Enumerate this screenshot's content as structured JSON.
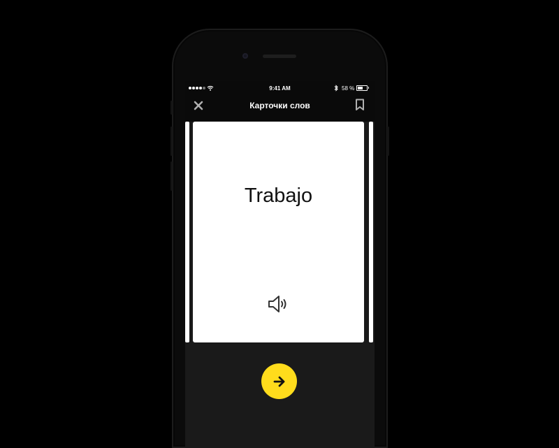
{
  "status_bar": {
    "time": "9:41 AM",
    "battery_percent": "58 %",
    "signal_bars": 4,
    "icons": [
      "signal-icon",
      "wifi-icon",
      "bluetooth-icon",
      "battery-icon"
    ]
  },
  "navbar": {
    "title": "Карточки слов",
    "close_icon": "close-icon",
    "bookmark_icon": "bookmark-icon"
  },
  "card": {
    "word": "Trabajo",
    "audio_icon": "speaker-icon"
  },
  "next_button": {
    "icon": "arrow-right-icon",
    "color": "#FFDC1C"
  },
  "colors": {
    "background": "#000000",
    "screen": "#1A1A1A",
    "accent": "#FFDC1C",
    "card": "#FFFFFF"
  }
}
